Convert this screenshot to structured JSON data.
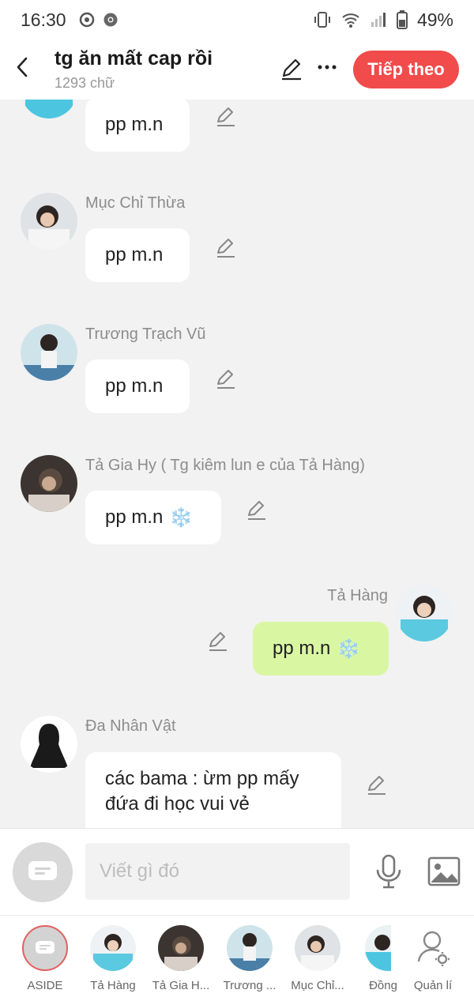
{
  "status_bar": {
    "time": "16:30",
    "battery": "49%"
  },
  "header": {
    "title": "tg ăn mất cap rồi",
    "subtitle": "1293 chữ",
    "next_label": "Tiếp theo"
  },
  "messages": [
    {
      "name": "",
      "text": "pp m.n",
      "snow": false,
      "side": "left"
    },
    {
      "name": "Mục Chỉ Thừa",
      "text": "pp m.n",
      "snow": false,
      "side": "left"
    },
    {
      "name": "Trương Trạch Vũ",
      "text": "pp m.n",
      "snow": false,
      "side": "left"
    },
    {
      "name": "Tả Gia Hy ( Tg kiêm lun e của Tả Hàng)",
      "text": "pp m.n",
      "snow": true,
      "side": "left"
    },
    {
      "name": "Tả Hàng",
      "text": "pp m.n",
      "snow": true,
      "side": "right"
    },
    {
      "name": "Đa Nhân Vật",
      "text": "các bama : ừm pp mấy đứa đi học vui vẻ",
      "snow": false,
      "side": "left"
    }
  ],
  "snow_glyph": "❄️",
  "composer": {
    "placeholder": "Viết gì đó"
  },
  "characters": [
    {
      "label": "ASIDE"
    },
    {
      "label": "Tả Hàng"
    },
    {
      "label": "Tả Gia H..."
    },
    {
      "label": "Trương ..."
    },
    {
      "label": "Mục Chỉ..."
    },
    {
      "label": "Đồng"
    },
    {
      "label": "Quản lí"
    }
  ],
  "colors": {
    "accent": "#f14b4b",
    "my_bubble": "#d9f7a3",
    "background": "#f2f2f2"
  }
}
